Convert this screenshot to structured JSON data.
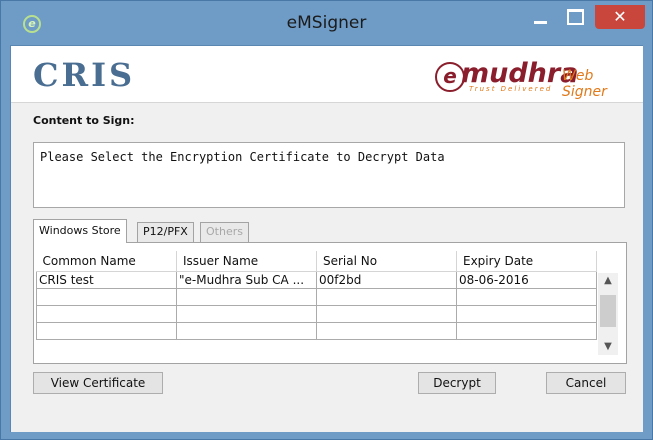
{
  "window": {
    "title": "eMSigner",
    "close_glyph": "✕"
  },
  "header": {
    "left_logo": "CRIS",
    "right_logo_mark": "e",
    "right_logo_text": "mudhra",
    "right_logo_tagline": "Trust Delivered",
    "right_logo_suffix": "Web Signer"
  },
  "content": {
    "label": "Content to Sign:",
    "text": "Please Select the Encryption Certificate to Decrypt Data"
  },
  "tabs": [
    {
      "label": "Windows Store",
      "active": true
    },
    {
      "label": "P12/PFX",
      "active": false
    },
    {
      "label": "Others",
      "active": false,
      "disabled": true
    }
  ],
  "table": {
    "columns": [
      "Common Name",
      "Issuer Name",
      "Serial No",
      "Expiry Date"
    ],
    "rows": [
      [
        "CRIS test",
        "\"e-Mudhra Sub CA ...",
        "00f2bd",
        "08-06-2016"
      ],
      [
        "",
        "",
        "",
        ""
      ],
      [
        "",
        "",
        "",
        ""
      ],
      [
        "",
        "",
        "",
        ""
      ]
    ]
  },
  "scrollbar": {
    "up_icon": "chevron-up-icon",
    "down_icon": "chevron-down-icon",
    "up_glyph": "▲",
    "down_glyph": "▼"
  },
  "buttons": {
    "view_certificate": "View Certificate",
    "decrypt": "Decrypt",
    "cancel": "Cancel"
  },
  "colors": {
    "titlebar": "#6e9cc7",
    "close_button": "#c9463d",
    "brand_emudhra": "#8a1e2c",
    "brand_orange": "#e07a1a",
    "brand_cris": "#4a6e91"
  }
}
